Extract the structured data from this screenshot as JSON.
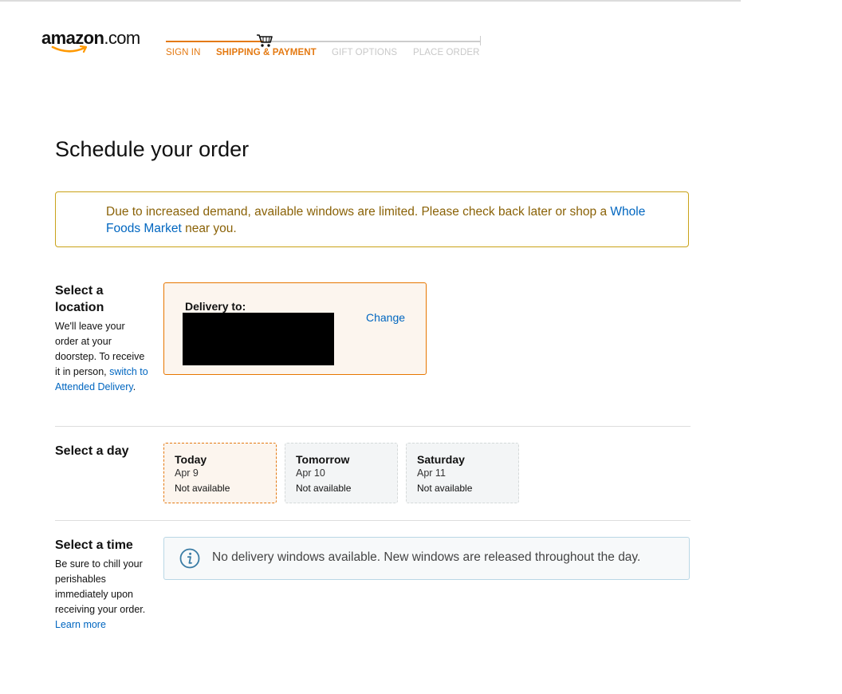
{
  "header": {
    "logo": {
      "brand": "amazon",
      "suffix": ".com"
    },
    "checkout_steps": [
      {
        "label": "SIGN IN",
        "state": "done"
      },
      {
        "label": "SHIPPING & PAYMENT",
        "state": "active"
      },
      {
        "label": "GIFT OPTIONS",
        "state": "todo"
      },
      {
        "label": "PLACE ORDER",
        "state": "todo"
      }
    ],
    "icon": "shopping-cart-icon"
  },
  "page_title": "Schedule your order",
  "alert": {
    "text_before": "Due to increased demand, available windows are limited. Please check back later or shop a ",
    "link": "Whole Foods Market",
    "text_after": " near you."
  },
  "location": {
    "title": "Select a location",
    "desc_before": "We'll leave your order at your doorstep. To receive it in person, ",
    "desc_link": "switch to Attended Delivery",
    "desc_after": ".",
    "delivery_label": "Delivery to:",
    "change_label": "Change"
  },
  "day": {
    "title": "Select a day",
    "options": [
      {
        "name": "Today",
        "date": "Apr 9",
        "status": "Not available",
        "selected": true
      },
      {
        "name": "Tomorrow",
        "date": "Apr 10",
        "status": "Not available",
        "selected": false
      },
      {
        "name": "Saturday",
        "date": "Apr 11",
        "status": "Not available",
        "selected": false
      }
    ]
  },
  "time": {
    "title": "Select a time",
    "desc": "Be sure to chill your perishables immediately upon receiving your order.",
    "learn_more": "Learn more",
    "info_icon": "info-icon",
    "info_text": "No delivery windows available. New windows are released throughout the day."
  },
  "colors": {
    "accent_orange": "#e47911",
    "link_blue": "#0066c0",
    "alert_text": "#8a6207",
    "alert_border": "#c9a21a"
  }
}
